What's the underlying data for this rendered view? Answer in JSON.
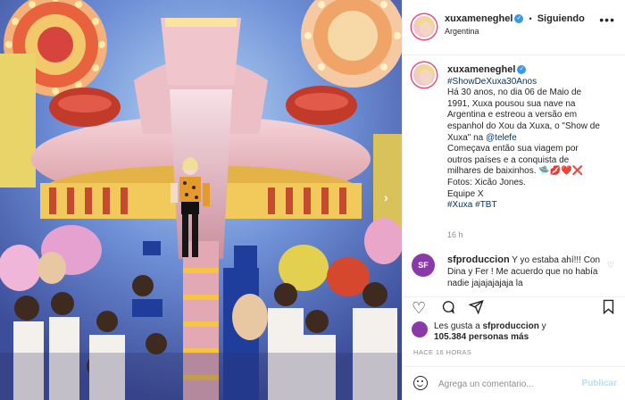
{
  "header": {
    "username": "xuxameneghel",
    "separator": "•",
    "follow_status": "Siguiendo",
    "location": "Argentina",
    "more_label": "•••"
  },
  "caption": {
    "username": "xuxameneghel",
    "hashtag_top": "#ShowDeXuxa30Anos",
    "lines": [
      "Há 30 anos, no dia 06 de Maio de",
      "1991, Xuxa pousou sua nave na",
      "Argentina e estreou a versão em",
      "espanhol do Xou da Xuxa, o \"Show de",
      "Xuxa\" na"
    ],
    "mention": "@telefe",
    "lines2": [
      "Começava então sua viagem por",
      "outros países e a conquista de",
      "milhares de baixinhos. 🛸💋❤️❌",
      "Fotos: Xicão Jones.",
      "Equipe X"
    ],
    "hashtags_bottom": "#Xuxa #TBT",
    "time": "16 h"
  },
  "comment": {
    "avatar_text": "SF",
    "username": "sfproduccion",
    "text": "Y yo estaba ahí!!! Con Dina y Fer ! Me acuerdo que no había nadie jajajajajaja la"
  },
  "likes": {
    "prefix": "Les gusta a",
    "user": "sfproduccion",
    "conj": "y",
    "count": "105.384 personas más"
  },
  "time_ago": "HACE 16 HORAS",
  "add_comment": {
    "placeholder": "Agrega un comentario...",
    "publish": "Publicar"
  },
  "icons": {
    "heart": "heart-icon",
    "comment": "comment-icon",
    "share": "share-icon",
    "bookmark": "bookmark-icon"
  }
}
